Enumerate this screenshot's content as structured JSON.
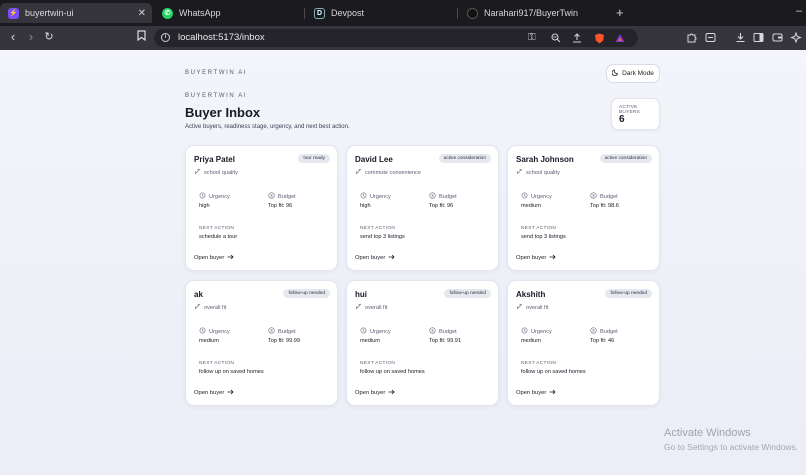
{
  "browser": {
    "tabs": [
      {
        "title": "buyertwin-ui",
        "close": "✕"
      },
      {
        "title": "WhatsApp"
      },
      {
        "title": "Devpost"
      },
      {
        "title": "Narahari917/BuyerTwin"
      }
    ],
    "new_tab": "+",
    "minimize": "–",
    "address": "localhost:5173/inbox"
  },
  "page": {
    "brand": "BUYERTWIN AI",
    "dark_mode_label": "Dark Mode",
    "eyebrow": "BUYERTWIN AI",
    "title": "Buyer Inbox",
    "subtitle": "Active buyers, readiness stage, urgency, and next best action.",
    "active_buyers_label": "ACTIVE BUYERS",
    "active_buyers_count": "6"
  },
  "card_labels": {
    "urgency": "Urgency",
    "budget": "Budget",
    "next_action": "NEXT ACTION",
    "open_buyer": "Open buyer"
  },
  "buyers": [
    {
      "name": "Priya Patel",
      "stage": "tour ready",
      "focus": "school quality",
      "urgency": "high",
      "fit": "Top fit: 96",
      "next_action": "schedule a tour"
    },
    {
      "name": "David Lee",
      "stage": "active consideration",
      "focus": "commute convenience",
      "urgency": "high",
      "fit": "Top fit: 96",
      "next_action": "send top 3 listings"
    },
    {
      "name": "Sarah Johnson",
      "stage": "active consideration",
      "focus": "school quality",
      "urgency": "medium",
      "fit": "Top fit: 98.6",
      "next_action": "send top 3 listings"
    },
    {
      "name": "ak",
      "stage": "follow-up needed",
      "focus": "overall fit",
      "urgency": "medium",
      "fit": "Top fit: 99.99",
      "next_action": "follow up on saved homes"
    },
    {
      "name": "hui",
      "stage": "follow-up needed",
      "focus": "overall fit",
      "urgency": "medium",
      "fit": "Top fit: 99.91",
      "next_action": "follow up on saved homes"
    },
    {
      "name": "Akshith",
      "stage": "follow-up needed",
      "focus": "overall fit",
      "urgency": "medium",
      "fit": "Top fit: 46",
      "next_action": "follow up on saved homes"
    }
  ],
  "os": {
    "activate_title": "Activate Windows",
    "activate_sub": "Go to Settings to activate Windows."
  }
}
